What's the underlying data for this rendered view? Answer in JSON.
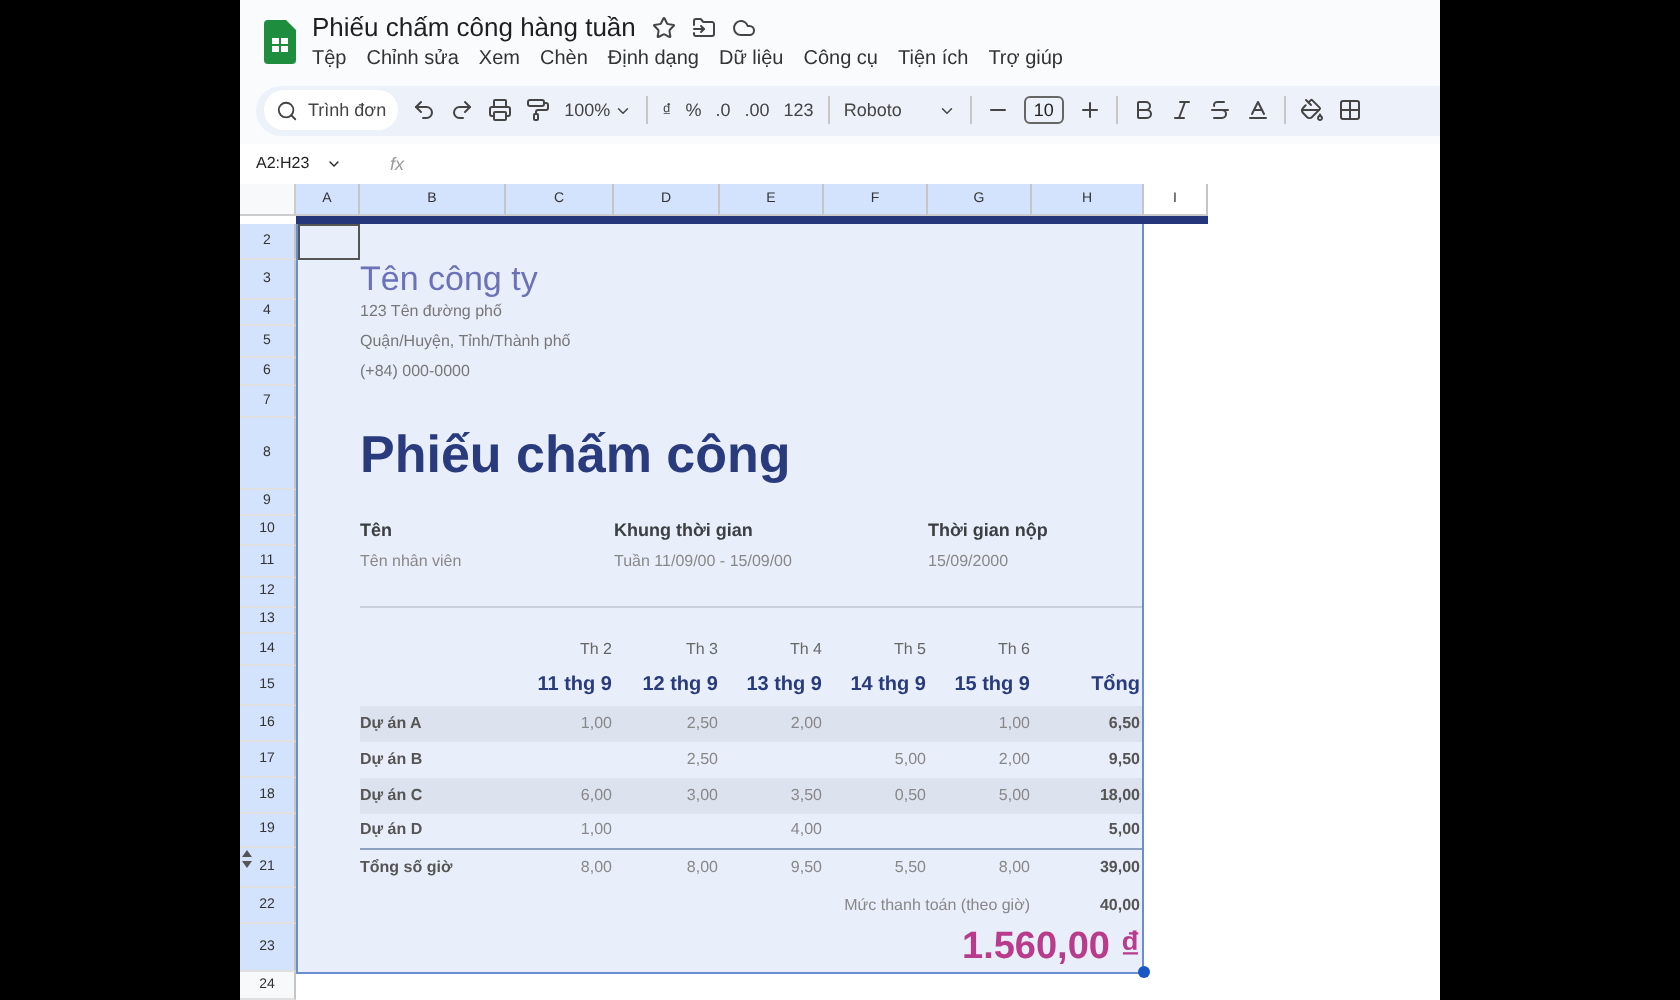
{
  "app": {
    "title": "Phiếu chấm công hàng tuần",
    "menus": [
      "Tệp",
      "Chỉnh sửa",
      "Xem",
      "Chèn",
      "Định dạng",
      "Dữ liệu",
      "Công cụ",
      "Tiện ích",
      "Trợ giúp"
    ]
  },
  "toolbar": {
    "search": "Trình đơn",
    "zoom": "100%",
    "format_buttons": [
      "₫",
      "%",
      ".0",
      ".00",
      "123"
    ],
    "font": "Roboto",
    "font_size": "10"
  },
  "formula_bar": {
    "range": "A2:H23",
    "fx": "fx"
  },
  "columns": [
    "A",
    "B",
    "C",
    "D",
    "E",
    "F",
    "G",
    "H",
    "I"
  ],
  "rows": [
    "2",
    "3",
    "4",
    "5",
    "6",
    "7",
    "8",
    "9",
    "10",
    "11",
    "12",
    "13",
    "14",
    "15",
    "16",
    "17",
    "18",
    "19",
    "21",
    "22",
    "23",
    "24"
  ],
  "sheet": {
    "company": {
      "name": "Tên công ty",
      "address": [
        "123 Tên đường phố",
        "Quận/Huyện, Tỉnh/Thành phố",
        "(+84) 000-0000"
      ]
    },
    "title": "Phiếu chấm công",
    "info": [
      {
        "label": "Tên",
        "value": "Tên nhân viên"
      },
      {
        "label": "Khung thời gian",
        "value": "Tuần 11/09/00 - 15/09/00"
      },
      {
        "label": "Thời gian nộp",
        "value": "15/09/2000"
      }
    ],
    "days": [
      {
        "day": "Th 2",
        "date": "11 thg 9"
      },
      {
        "day": "Th 3",
        "date": "12 thg 9"
      },
      {
        "day": "Th 4",
        "date": "13 thg 9"
      },
      {
        "day": "Th 5",
        "date": "14 thg 9"
      },
      {
        "day": "Th 6",
        "date": "15 thg 9"
      }
    ],
    "total_header": "Tổng",
    "projects": [
      {
        "name": "Dự án A",
        "hours": {
          "day_1": "1,00",
          "day_2": "2,50",
          "day_3": "2,00",
          "day_5": "1,00"
        },
        "total": "6,50"
      },
      {
        "name": "Dự án B",
        "hours": {
          "day_2": "2,50",
          "day_4": "5,00",
          "day_5": "2,00"
        },
        "total": "9,50"
      },
      {
        "name": "Dự án C",
        "hours": {
          "day_1": "6,00",
          "day_2": "3,00",
          "day_3": "3,50",
          "day_4": "0,50",
          "day_5": "5,00"
        },
        "total": "18,00"
      },
      {
        "name": "Dự án D",
        "hours": {
          "day_1": "1,00",
          "day_3": "4,00"
        },
        "total": "5,00"
      }
    ],
    "totals": {
      "label": "Tổng số giờ",
      "hours": [
        "8,00",
        "8,00",
        "9,50",
        "5,50",
        "8,00"
      ],
      "total": "39,00"
    },
    "rate": {
      "label": "Mức thanh toán (theo giờ)",
      "value": "40,00"
    },
    "grand_total": "1.560,00 ₫"
  }
}
